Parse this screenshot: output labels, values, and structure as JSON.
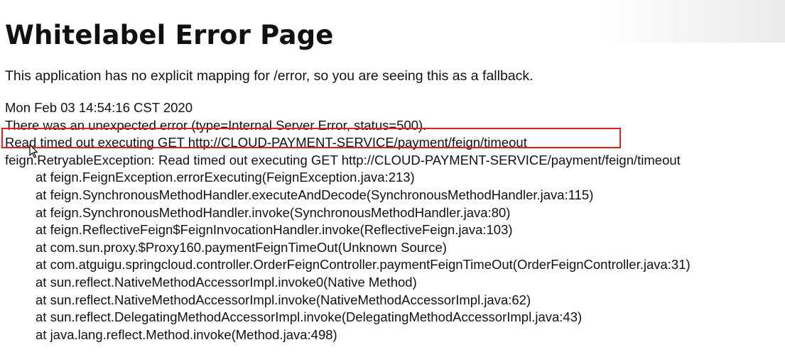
{
  "page": {
    "title": "Whitelabel Error Page",
    "fallback_message": "This application has no explicit mapping for /error, so you are seeing this as a fallback."
  },
  "error": {
    "timestamp": "Mon Feb 03 14:54:16 CST 2020",
    "summary": "There was an unexpected error (type=Internal Server Error, status=500).",
    "message": "Read timed out executing GET http://CLOUD-PAYMENT-SERVICE/payment/feign/timeout",
    "exception": "feign.RetryableException: Read timed out executing GET http://CLOUD-PAYMENT-SERVICE/payment/feign/timeout",
    "stack_trace": [
      "at feign.FeignException.errorExecuting(FeignException.java:213)",
      "at feign.SynchronousMethodHandler.executeAndDecode(SynchronousMethodHandler.java:115)",
      "at feign.SynchronousMethodHandler.invoke(SynchronousMethodHandler.java:80)",
      "at feign.ReflectiveFeign$FeignInvocationHandler.invoke(ReflectiveFeign.java:103)",
      "at com.sun.proxy.$Proxy160.paymentFeignTimeOut(Unknown Source)",
      "at com.atguigu.springcloud.controller.OrderFeignController.paymentFeignTimeOut(OrderFeignController.java:31)",
      "at sun.reflect.NativeMethodAccessorImpl.invoke0(Native Method)",
      "at sun.reflect.NativeMethodAccessorImpl.invoke(NativeMethodAccessorImpl.java:62)",
      "at sun.reflect.DelegatingMethodAccessorImpl.invoke(DelegatingMethodAccessorImpl.java:43)",
      "at java.lang.reflect.Method.invoke(Method.java:498)"
    ]
  },
  "annotation": {
    "highlight_color": "#e0201e"
  },
  "icons": {
    "cursor": "mouse-pointer-icon"
  }
}
